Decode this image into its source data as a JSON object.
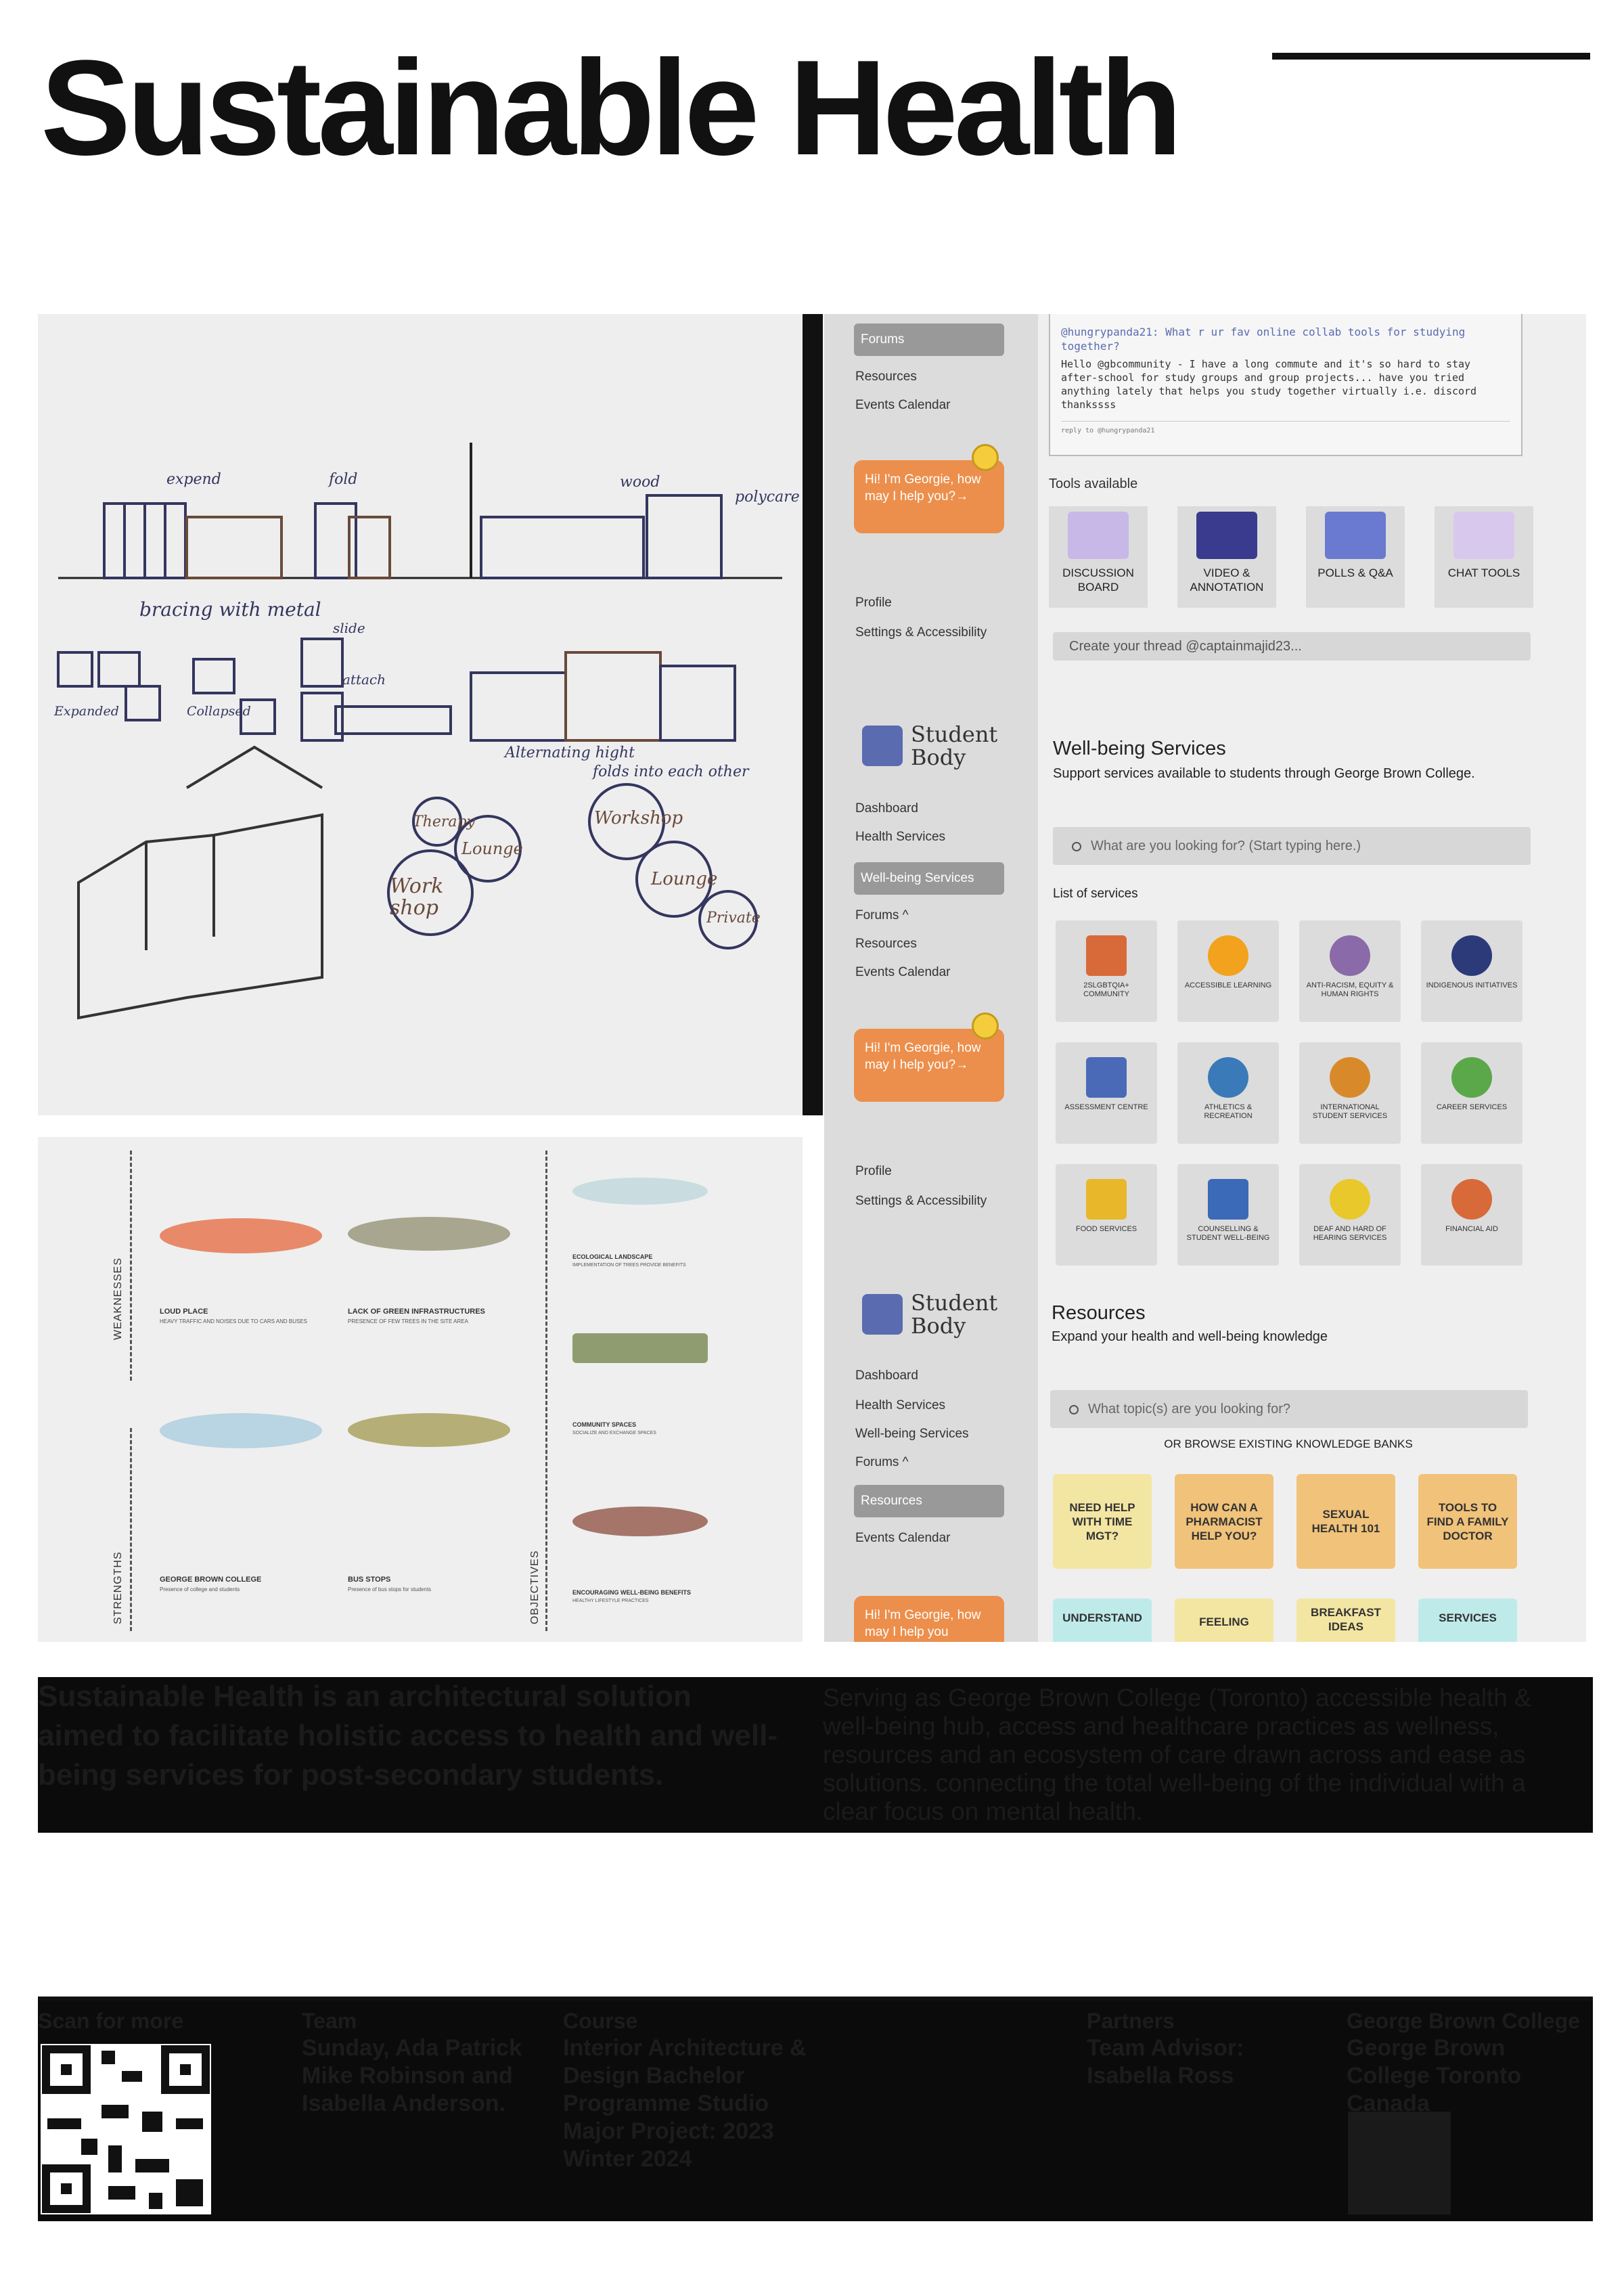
{
  "title": "Sustainable Health",
  "sketch": {
    "annotations": [
      "expend",
      "fold",
      "wood",
      "polycare",
      "bracing with metal",
      "slide",
      "attach",
      "Expanded",
      "Collapsed",
      "Alternating hight",
      "folds into each other",
      "Therapy",
      "Lounge",
      "Work shop",
      "Workshop",
      "Lounge",
      "Private"
    ]
  },
  "diagram": {
    "weaknesses_label": "WEAKNESSES",
    "strengths_label": "STRENGTHS",
    "objectives_label": "OBJECTIVES",
    "items": [
      {
        "title": "LOUD PLACE",
        "desc": "HEAVY TRAFFIC AND NOISES DUE TO CARS AND BUSES"
      },
      {
        "title": "LACK OF GREEN INFRASTRUCTURES",
        "desc": "PRESENCE OF FEW TREES IN THE SITE AREA"
      },
      {
        "title": "GEORGE BROWN COLLEGE",
        "desc": "Presence of college and students"
      },
      {
        "title": "BUS STOPS",
        "desc": "Presence of bus stops for students"
      },
      {
        "title": "ECOLOGICAL LANDSCAPE",
        "desc": "IMPLEMENTATION OF TREES PROVIDE BENEFITS"
      },
      {
        "title": "COMMUNITY SPACES",
        "desc": "SOCIALIZE AND EXCHANGE SPACES"
      },
      {
        "title": "ENCOURAGING WELL-BEING BENEFITS",
        "desc": "HEALTHY LIFESTYLE PRACTICES"
      }
    ]
  },
  "ui": {
    "panel1": {
      "nav_selected": "Forums",
      "nav": [
        "Resources",
        "Events Calendar"
      ],
      "chatbot": "Hi! I'm Georgie, how may I help you?→",
      "bottom": [
        "Profile",
        "Settings & Accessibility"
      ]
    },
    "forum": {
      "post_head": "@hungrypanda21: What r ur fav online collab tools for studying together?",
      "post_body": "Hello @gbcommunity - I have a long commute and it's so hard to stay after-school for study groups and group projects... have you tried anything lately that helps you study together virtually i.e. discord thankssss",
      "reply": "reply to @hungrypanda21",
      "tools_heading": "Tools available",
      "tools": [
        "DISCUSSION BOARD",
        "VIDEO & ANNOTATION",
        "POLLS & Q&A",
        "CHAT TOOLS"
      ],
      "create_thread": "Create your thread @captainmajid23..."
    },
    "panel2": {
      "logo": "Student Body",
      "nav": [
        "Dashboard",
        "Health Services"
      ],
      "nav_selected": "Well-being Services",
      "nav_after": [
        "Forums ^",
        "Resources",
        "Events Calendar"
      ],
      "chatbot": "Hi! I'm Georgie, how may I help you?→",
      "bottom": [
        "Profile",
        "Settings & Accessibility"
      ]
    },
    "wellbeing": {
      "title": "Well-being Services",
      "subtitle": "Support services available to students through George Brown College.",
      "search_placeholder": "What are you looking for? (Start typing here.)",
      "list_heading": "List of services",
      "services": [
        "2SLGBTQIA+ COMMUNITY",
        "ACCESSIBLE LEARNING",
        "ANTI-RACISM, EQUITY & HUMAN RIGHTS",
        "INDIGENOUS INITIATIVES",
        "ASSESSMENT CENTRE",
        "ATHLETICS & RECREATION",
        "INTERNATIONAL STUDENT SERVICES",
        "CAREER SERVICES",
        "FOOD SERVICES",
        "COUNSELLING & STUDENT WELL-BEING",
        "DEAF AND HARD OF HEARING SERVICES",
        "FINANCIAL AID"
      ]
    },
    "panel3": {
      "logo": "Student Body",
      "nav": [
        "Dashboard",
        "Health Services",
        "Well-being Services",
        "Forums ^"
      ],
      "nav_selected": "Resources",
      "nav_after": [
        "Events Calendar"
      ],
      "chatbot": "Hi! I'm Georgie, how may I help you"
    },
    "resources": {
      "title": "Resources",
      "subtitle": "Expand your  health and well-being knowledge",
      "search_placeholder": "What topic(s) are you looking for?",
      "browse": "OR BROWSE EXISTING KNOWLEDGE BANKS",
      "banks": [
        "NEED HELP WITH TIME MGT?",
        "HOW CAN A PHARMACIST HELP YOU?",
        "SEXUAL HEALTH 101",
        "TOOLS TO FIND A FAMILY DOCTOR",
        "UNDERSTAND",
        "FEELING",
        "BREAKFAST IDEAS",
        "SERVICES"
      ]
    }
  },
  "description": {
    "left": "Sustainable Health is an architectural solution aimed to facilitate holistic access to health and well-being services for post-secondary students.",
    "right": "Serving as George Brown College (Toronto) accessible health & well-being hub, access and healthcare practices as wellness, resources and an ecosystem of care drawn across and ease as solutions. connecting the total well-being of the individual with a clear focus on mental health."
  },
  "footer": {
    "cols": [
      {
        "head": "Scan for more",
        "body": ""
      },
      {
        "head": "Team",
        "body": "Sunday, Ada Patrick Mike Robinson and Isabella Anderson."
      },
      {
        "head": "Course",
        "body": "Interior Architecture & Design Bachelor Programme Studio Major Project: 2023 Winter 2024"
      },
      {
        "head": "Partners",
        "body": "Team Advisor: Isabella Ross"
      },
      {
        "head": "George Brown College",
        "body": "George Brown College Toronto Canada"
      }
    ]
  },
  "colors": {
    "orange": "#ec8f4c",
    "logo_blue": "#5a6bb0",
    "kb_yellow": "#f3e6a3",
    "kb_orange": "#f0c27a",
    "kb_cyan": "#bfeaea"
  }
}
